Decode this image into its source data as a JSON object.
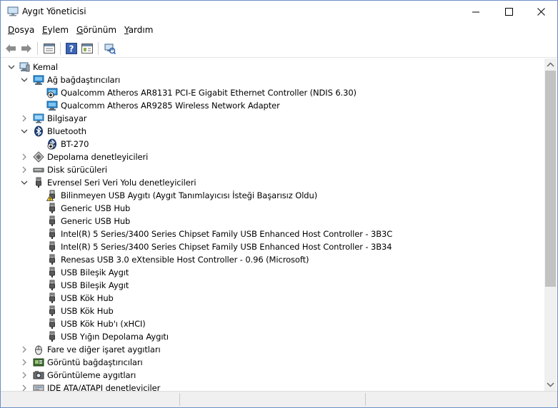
{
  "window": {
    "title": "Aygıt Yöneticisi"
  },
  "menu": [
    {
      "label": "Dosya",
      "key": "D",
      "rest": "osya"
    },
    {
      "label": "Eylem",
      "key": "E",
      "rest": "ylem"
    },
    {
      "label": "Görünüm",
      "key": "G",
      "rest": "örünüm"
    },
    {
      "label": "Yardım",
      "key": "Y",
      "rest": "ardım"
    }
  ],
  "toolbar": [
    "back-icon",
    "forward-icon",
    "properties-icon",
    "help-icon",
    "device-view-icon",
    "scan-hardware-icon"
  ],
  "tree": [
    {
      "label": "Kemal",
      "level": 0,
      "state": "expanded",
      "icon": "computer-icon"
    },
    {
      "label": "Ağ bağdaştırıcıları",
      "level": 1,
      "state": "expanded",
      "icon": "network-adapter-icon"
    },
    {
      "label": "Qualcomm Atheros AR8131 PCI-E Gigabit Ethernet Controller (NDIS 6.30)",
      "level": 2,
      "state": "leaf",
      "icon": "network-disabled-icon"
    },
    {
      "label": "Qualcomm Atheros AR9285 Wireless Network Adapter",
      "level": 2,
      "state": "leaf",
      "icon": "network-adapter-icon"
    },
    {
      "label": "Bilgisayar",
      "level": 1,
      "state": "collapsed",
      "icon": "monitor-icon"
    },
    {
      "label": "Bluetooth",
      "level": 1,
      "state": "expanded",
      "icon": "bluetooth-icon"
    },
    {
      "label": "BT-270",
      "level": 2,
      "state": "leaf",
      "icon": "bluetooth-disabled-icon"
    },
    {
      "label": "Depolama denetleyicileri",
      "level": 1,
      "state": "collapsed",
      "icon": "storage-controller-icon"
    },
    {
      "label": "Disk sürücüleri",
      "level": 1,
      "state": "collapsed",
      "icon": "disk-drive-icon"
    },
    {
      "label": "Evrensel Seri Veri Yolu denetleyicileri",
      "level": 1,
      "state": "expanded",
      "icon": "usb-icon"
    },
    {
      "label": "Bilinmeyen USB Aygıtı (Aygıt Tanımlayıcısı İsteği Başarısız Oldu)",
      "level": 2,
      "state": "leaf",
      "icon": "usb-warning-icon"
    },
    {
      "label": "Generic USB Hub",
      "level": 2,
      "state": "leaf",
      "icon": "usb-icon"
    },
    {
      "label": "Generic USB Hub",
      "level": 2,
      "state": "leaf",
      "icon": "usb-icon"
    },
    {
      "label": "Intel(R) 5 Series/3400 Series Chipset Family USB Enhanced Host Controller - 3B3C",
      "level": 2,
      "state": "leaf",
      "icon": "usb-icon"
    },
    {
      "label": "Intel(R) 5 Series/3400 Series Chipset Family USB Enhanced Host Controller - 3B34",
      "level": 2,
      "state": "leaf",
      "icon": "usb-icon"
    },
    {
      "label": "Renesas USB 3.0 eXtensible Host Controller - 0.96 (Microsoft)",
      "level": 2,
      "state": "leaf",
      "icon": "usb-icon"
    },
    {
      "label": "USB Bileşik Aygıt",
      "level": 2,
      "state": "leaf",
      "icon": "usb-icon"
    },
    {
      "label": "USB Bileşik Aygıt",
      "level": 2,
      "state": "leaf",
      "icon": "usb-icon"
    },
    {
      "label": "USB Kök Hub",
      "level": 2,
      "state": "leaf",
      "icon": "usb-icon"
    },
    {
      "label": "USB Kök Hub",
      "level": 2,
      "state": "leaf",
      "icon": "usb-icon"
    },
    {
      "label": "USB Kök Hub'ı (xHCI)",
      "level": 2,
      "state": "leaf",
      "icon": "usb-icon"
    },
    {
      "label": "USB Yığın Depolama Aygıtı",
      "level": 2,
      "state": "leaf",
      "icon": "usb-icon"
    },
    {
      "label": "Fare ve diğer işaret aygıtları",
      "level": 1,
      "state": "collapsed",
      "icon": "mouse-icon"
    },
    {
      "label": "Görüntü bağdaştırıcıları",
      "level": 1,
      "state": "collapsed",
      "icon": "display-adapter-icon"
    },
    {
      "label": "Görüntüleme aygıtları",
      "level": 1,
      "state": "collapsed",
      "icon": "camera-icon"
    },
    {
      "label": "IDE ATA/ATAPI denetleyiciler",
      "level": 1,
      "state": "collapsed",
      "icon": "ide-icon"
    }
  ]
}
